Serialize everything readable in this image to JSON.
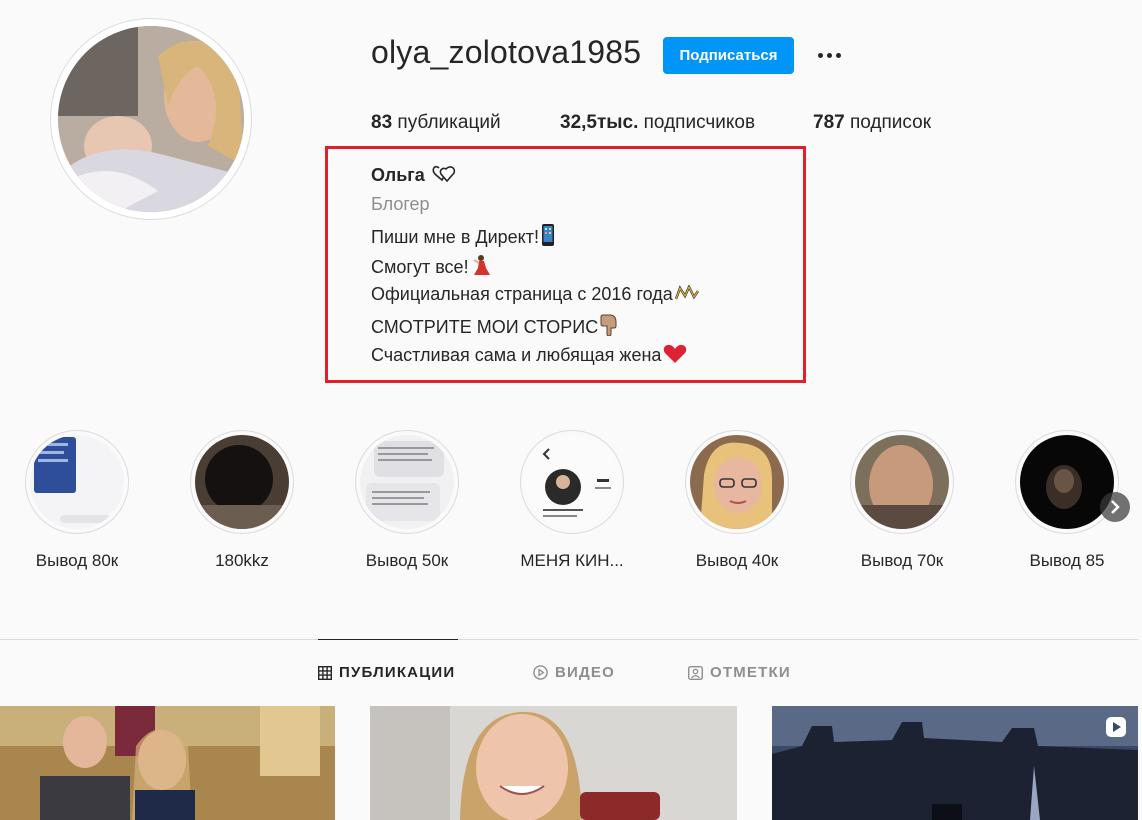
{
  "profile": {
    "username": "olya_zolotova1985",
    "follow_label": "Подписаться",
    "more_icon": "more-dots-icon"
  },
  "stats": {
    "posts_count": "83",
    "posts_label": "публикаций",
    "followers_count": "32,5тыс.",
    "followers_label": "подписчиков",
    "following_count": "787",
    "following_label": "подписок"
  },
  "bio": {
    "name": "Ольга",
    "category": "Блогер",
    "lines": [
      "Пиши мне в Директ!",
      "Смогут все!",
      "Официальная страница с 2016 года",
      "СМОТРИТЕ МОИ СТОРИС",
      "Счастливая сама и любящая жена"
    ],
    "highlight_color": "#e3202a"
  },
  "highlights": [
    {
      "label": "Вывод 80к"
    },
    {
      "label": "180kkz"
    },
    {
      "label": "Вывод 50к"
    },
    {
      "label": "МЕНЯ КИН..."
    },
    {
      "label": "Вывод 40к"
    },
    {
      "label": "Вывод 70к"
    },
    {
      "label": "Вывод 85"
    }
  ],
  "tabs": [
    {
      "label": "ПУБЛИКАЦИИ",
      "icon": "grid-icon",
      "active": true
    },
    {
      "label": "ВИДЕО",
      "icon": "play-circle-icon",
      "active": false
    },
    {
      "label": "ОТМЕТКИ",
      "icon": "tagged-user-icon",
      "active": false
    }
  ],
  "colors": {
    "accent": "#0095f6",
    "text": "#262626",
    "muted": "#8e8e8e",
    "background": "#fafafa"
  }
}
